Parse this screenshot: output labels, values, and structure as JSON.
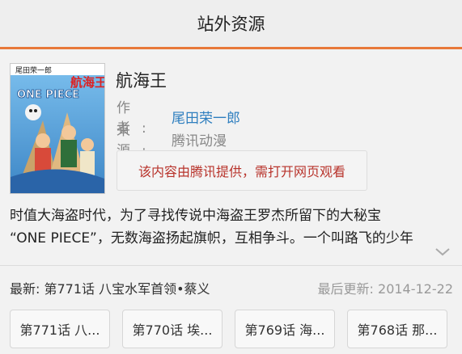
{
  "header": {
    "title": "站外资源"
  },
  "book": {
    "cover_author_text": "尾田荣一郎",
    "cover_title_text": "航海王",
    "cover_logo_text": "ONE PIECE",
    "title": "航海王",
    "author_label": "作者:",
    "author": "尾田荣一郎",
    "source_label": "来源:",
    "source": "腾讯动漫"
  },
  "notice": {
    "text": "该内容由腾讯提供，需打开网页观看"
  },
  "synopsis": {
    "line1": "时值大海盗时代，为了寻找传说中海盗王罗杰所留下的大秘宝",
    "line2": "“ONE PIECE”，无数海盗扬起旗帜，互相争斗。一个叫路飞的少年"
  },
  "latest": {
    "label": "最新: 第771话 八宝水军首领•蔡义",
    "updated": "最后更新: 2014-12-22"
  },
  "chapters": [
    {
      "label": "第771话 八..."
    },
    {
      "label": "第770话 埃..."
    },
    {
      "label": "第769话 海..."
    },
    {
      "label": "第768话 那..."
    }
  ],
  "colors": {
    "accent": "#e8783a",
    "link": "#2f7fbf",
    "notice_text": "#b8332b"
  }
}
